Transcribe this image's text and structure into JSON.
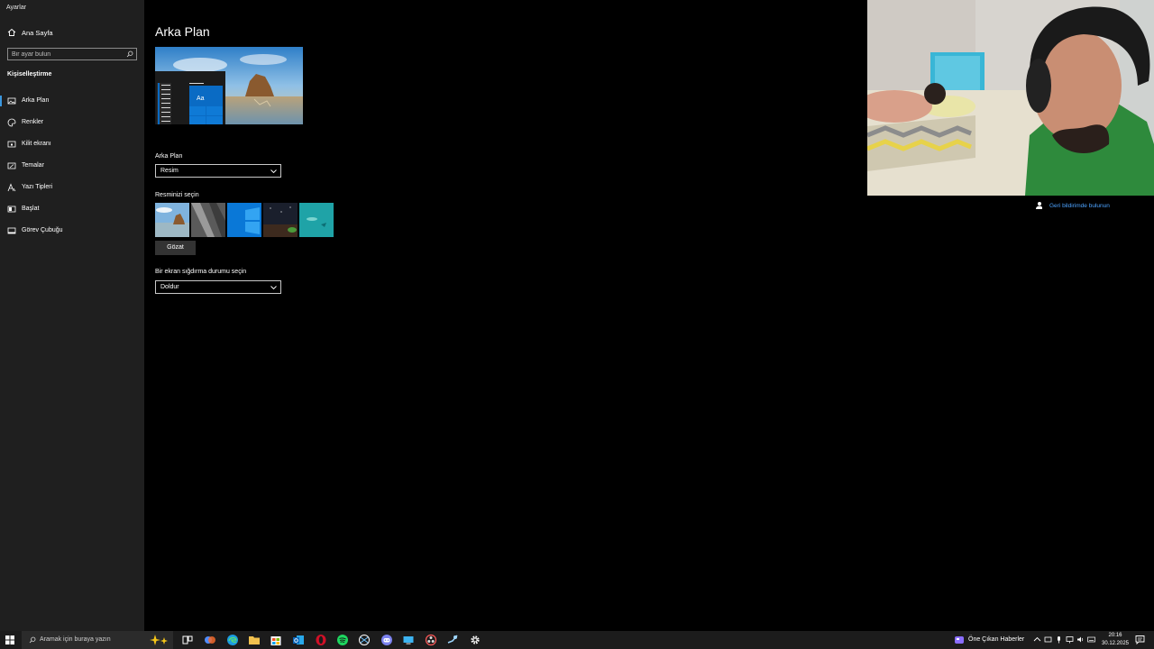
{
  "app": {
    "title": "Ayarlar"
  },
  "sidebar": {
    "home_label": "Ana Sayfa",
    "search_placeholder": "Bir ayar bulun",
    "section_title": "Kişiselleştirme",
    "items": [
      {
        "label": "Arka Plan",
        "icon": "picture-icon",
        "active": true
      },
      {
        "label": "Renkler",
        "icon": "palette-icon"
      },
      {
        "label": "Kilit ekranı",
        "icon": "lock-screen-icon"
      },
      {
        "label": "Temalar",
        "icon": "brush-icon"
      },
      {
        "label": "Yazı Tipleri",
        "icon": "font-icon"
      },
      {
        "label": "Başlat",
        "icon": "start-icon"
      },
      {
        "label": "Görev Çubuğu",
        "icon": "taskbar-icon"
      }
    ]
  },
  "main": {
    "title": "Arka Plan",
    "preview_tile_text": "Aa",
    "background_label": "Arka Plan",
    "background_value": "Resim",
    "choose_picture_label": "Resminizi seçin",
    "browse_label": "Gözat",
    "fit_label": "Bir ekran sığdırma durumu seçin",
    "fit_value": "Doldur"
  },
  "feedback": {
    "label": "Geri bildirimde bulunun",
    "icon": "feedback-icon"
  },
  "taskbar": {
    "search_placeholder": "Aramak için buraya yazın",
    "news_label": "Öne Çıkan Haberler",
    "apps": [
      "task-view-icon",
      "copilot-icon",
      "edge-icon",
      "file-explorer-icon",
      "store-icon",
      "outlook-icon",
      "opera-icon",
      "spotify-icon",
      "vpn-icon",
      "discord-icon",
      "desktop-app-icon",
      "obs-icon",
      "steam-icon",
      "settings-icon"
    ],
    "time": "20:16",
    "date": "30.12.2025"
  },
  "colors": {
    "sidebar_bg": "#1f1f1f",
    "accent": "#3a96dd",
    "link": "#4da3ff",
    "taskbar_bg": "#1c1c1c"
  }
}
